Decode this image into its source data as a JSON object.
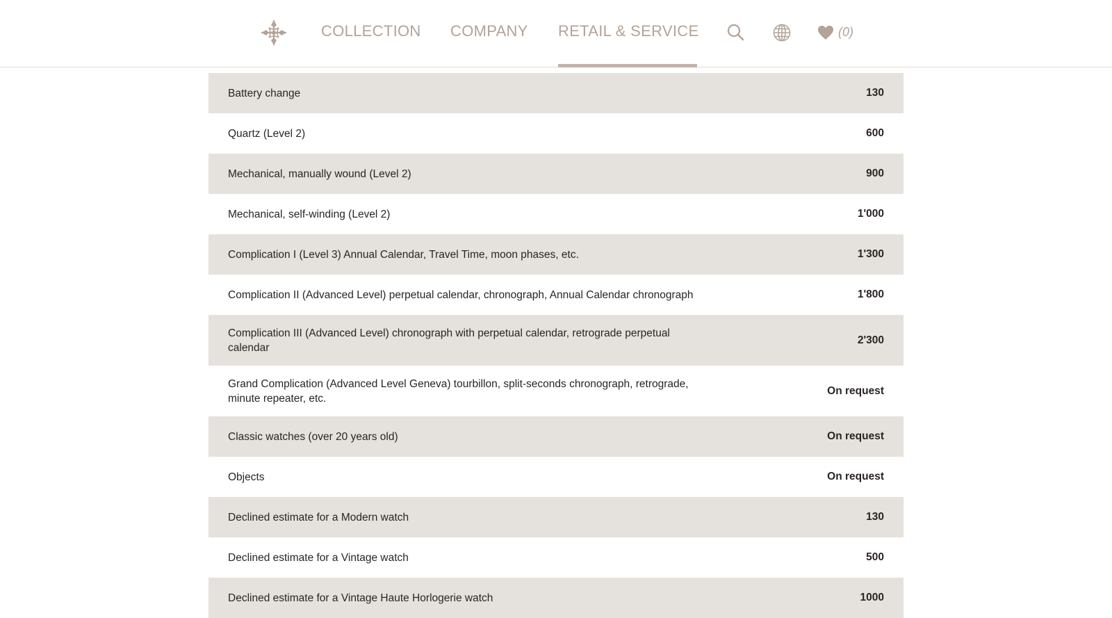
{
  "header": {
    "nav": [
      {
        "label": "COLLECTION"
      },
      {
        "label": "COMPANY"
      },
      {
        "label": "RETAIL & SERVICE",
        "active": true
      }
    ],
    "wishlist_count": "(0)",
    "icons": [
      "brand-cross-logo",
      "search-icon",
      "globe-icon",
      "heart-icon"
    ],
    "colors": {
      "nav_text": "#b4a398",
      "active_underline": "#c4b3aa",
      "row_shade": "#e5e1dd",
      "text": "#2a2523"
    }
  },
  "price_table": {
    "rows": [
      {
        "service": "Battery change",
        "price": "130"
      },
      {
        "service": "Quartz (Level 2)",
        "price": "600"
      },
      {
        "service": "Mechanical, manually wound (Level 2)",
        "price": "900"
      },
      {
        "service": "Mechanical, self-winding (Level 2)",
        "price": "1'000"
      },
      {
        "service": "Complication I (Level 3) Annual Calendar, Travel Time, moon phases, etc.",
        "price": "1'300"
      },
      {
        "service": "Complication II (Advanced Level) perpetual calendar, chronograph, Annual Calendar chronograph",
        "price": "1'800"
      },
      {
        "service": "Complication III (Advanced Level) chronograph with perpetual calendar, retrograde perpetual calendar",
        "price": "2'300"
      },
      {
        "service": "Grand Complication (Advanced Level Geneva) tourbillon, split-seconds chronograph, retrograde, minute repeater, etc.",
        "price": "On request"
      },
      {
        "service": "Classic watches (over 20 years old)",
        "price": "On request"
      },
      {
        "service": "Objects",
        "price": "On request"
      },
      {
        "service": "Declined estimate for a Modern watch",
        "price": "130"
      },
      {
        "service": "Declined estimate for a Vintage watch",
        "price": "500"
      },
      {
        "service": "Declined estimate for a Vintage Haute Horlogerie watch",
        "price": "1000"
      }
    ]
  }
}
